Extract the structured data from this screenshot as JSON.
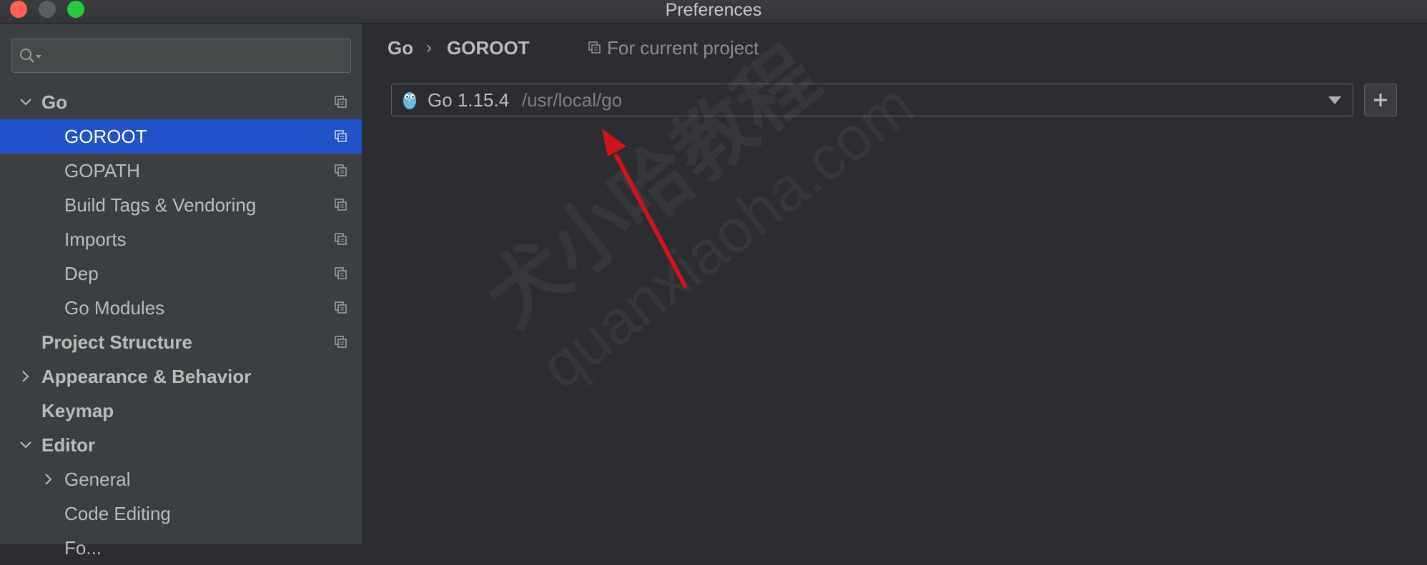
{
  "window": {
    "title": "Preferences"
  },
  "search": {
    "placeholder": ""
  },
  "sidebar": {
    "items": [
      {
        "label": "Go",
        "bold": true,
        "expanded": true
      },
      {
        "label": "GOROOT",
        "selected": true
      },
      {
        "label": "GOPATH"
      },
      {
        "label": "Build Tags & Vendoring"
      },
      {
        "label": "Imports"
      },
      {
        "label": "Dep"
      },
      {
        "label": "Go Modules"
      },
      {
        "label": "Project Structure",
        "bold": true
      },
      {
        "label": "Appearance & Behavior",
        "bold": true,
        "expanded": false
      },
      {
        "label": "Keymap",
        "bold": true
      },
      {
        "label": "Editor",
        "bold": true,
        "expanded": true
      },
      {
        "label": "General",
        "expanded": false
      },
      {
        "label": "Code Editing"
      },
      {
        "label": "Fo..."
      }
    ]
  },
  "breadcrumb": {
    "parent": "Go",
    "separator": "›",
    "current": "GOROOT"
  },
  "scope": {
    "label": "For current project"
  },
  "sdk": {
    "name": "Go 1.15.4",
    "path": "/usr/local/go"
  },
  "watermark": {
    "line1": "犬小哈教程",
    "line2": "quanxiaoha.com"
  },
  "colors": {
    "selection": "#2152c8",
    "annotation_arrow": "#d0121b",
    "sidebar_bg": "#3c3f41",
    "main_bg": "#2b2d30"
  }
}
